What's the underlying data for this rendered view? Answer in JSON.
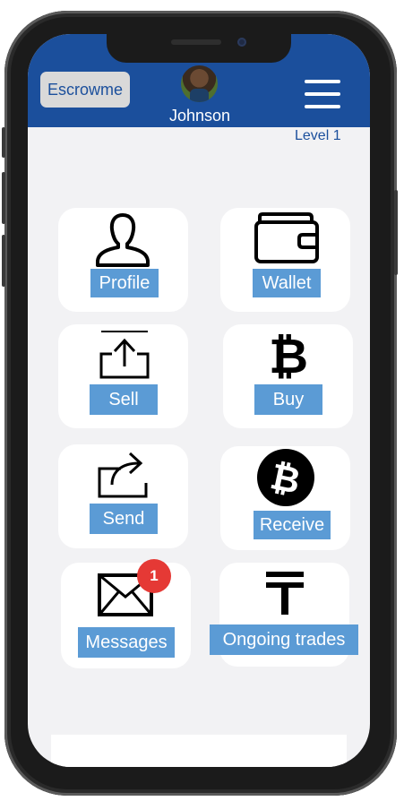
{
  "header": {
    "brand_label": "Escrowme",
    "user_name": "Johnson",
    "level": "Level 1"
  },
  "menu": {
    "profile": "Profile",
    "wallet": "Wallet",
    "sell": "Sell",
    "buy": "Buy",
    "send": "Send",
    "receive": "Receive",
    "messages": "Messages",
    "messages_badge": "1",
    "ongoing_trades": "Ongoing trades"
  },
  "icons": [
    "user-icon",
    "wallet-icon",
    "upload-icon",
    "bitcoin-icon",
    "share-icon",
    "bitcoin-circle-icon",
    "envelope-icon",
    "tenge-icon"
  ],
  "colors": {
    "header": "#1b4f9c",
    "label": "#5b9bd5",
    "badge": "#e53935",
    "screen": "#f2f2f4"
  }
}
